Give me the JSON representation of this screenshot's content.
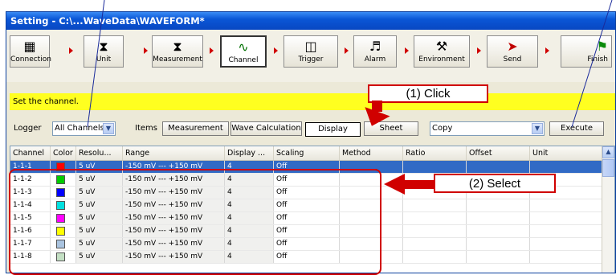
{
  "window": {
    "title": "Setting - C:\\...WaveData\\WAVEFORM*"
  },
  "toolbar": {
    "buttons": [
      {
        "label": "Connection",
        "icon": "network-icon"
      },
      {
        "label": "Unit",
        "icon": "unit-icon"
      },
      {
        "label": "Measurement",
        "icon": "hourglass-icon"
      },
      {
        "label": "Channel",
        "icon": "waveform-icon"
      },
      {
        "label": "Trigger",
        "icon": "trigger-icon"
      },
      {
        "label": "Alarm",
        "icon": "speaker-icon"
      },
      {
        "label": "Environment",
        "icon": "tools-icon"
      },
      {
        "label": "Send",
        "icon": "send-icon"
      },
      {
        "label": "Finish",
        "icon": "finish-flag-icon"
      }
    ],
    "active": "Channel"
  },
  "message": "Set the channel.",
  "filter": {
    "logger_label": "Logger",
    "logger_value": "All Channels",
    "items_label": "Items",
    "tabs": [
      "Measurement",
      "Wave Calculation",
      "Display",
      "Sheet"
    ],
    "active_tab": "Display",
    "action_value": "Copy",
    "execute_label": "Execute"
  },
  "table": {
    "headers": [
      "Channel",
      "Color",
      "Resolu...",
      "Range",
      "Display ...",
      "Scaling",
      "Method",
      "Ratio",
      "Offset",
      "Unit"
    ],
    "rows": [
      {
        "channel": "1-1-1",
        "color": "#ff0000",
        "resolution": "5 uV",
        "range": "-150 mV  ---  +150 mV",
        "display": "4",
        "scaling": "Off"
      },
      {
        "channel": "1-1-2",
        "color": "#00cc00",
        "resolution": "5 uV",
        "range": "-150 mV  ---  +150 mV",
        "display": "4",
        "scaling": "Off"
      },
      {
        "channel": "1-1-3",
        "color": "#0000ff",
        "resolution": "5 uV",
        "range": "-150 mV  ---  +150 mV",
        "display": "4",
        "scaling": "Off"
      },
      {
        "channel": "1-1-4",
        "color": "#00e0e0",
        "resolution": "5 uV",
        "range": "-150 mV  ---  +150 mV",
        "display": "4",
        "scaling": "Off"
      },
      {
        "channel": "1-1-5",
        "color": "#ff00ff",
        "resolution": "5 uV",
        "range": "-150 mV  ---  +150 mV",
        "display": "4",
        "scaling": "Off"
      },
      {
        "channel": "1-1-6",
        "color": "#ffff00",
        "resolution": "5 uV",
        "range": "-150 mV  ---  +150 mV",
        "display": "4",
        "scaling": "Off"
      },
      {
        "channel": "1-1-7",
        "color": "#aac4e0",
        "resolution": "5 uV",
        "range": "-150 mV  ---  +150 mV",
        "display": "4",
        "scaling": "Off"
      },
      {
        "channel": "1-1-8",
        "color": "#c4e0c4",
        "resolution": "5 uV",
        "range": "-150 mV  ---  +150 mV",
        "display": "4",
        "scaling": "Off"
      }
    ],
    "selected_index": 0
  },
  "annotations": {
    "click": "(1) Click",
    "select": "(2) Select"
  }
}
